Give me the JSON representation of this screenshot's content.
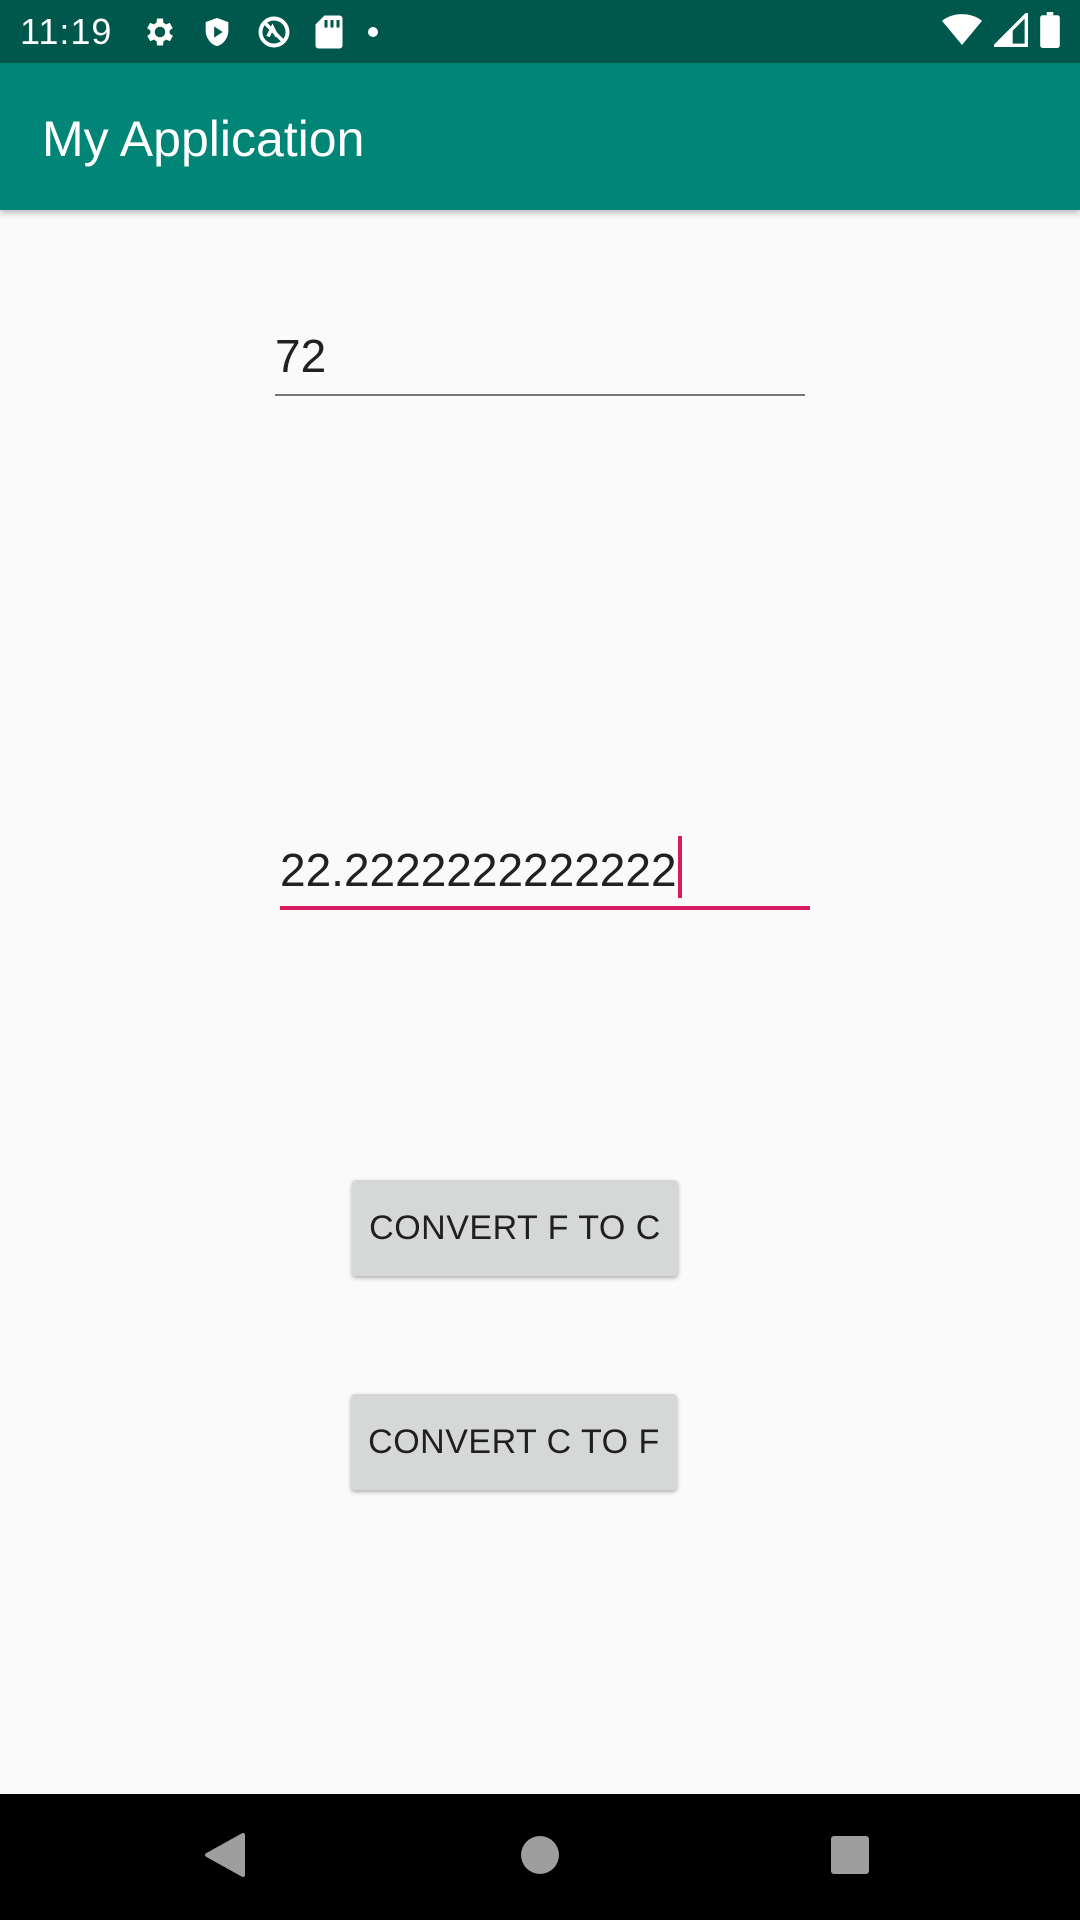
{
  "status_bar": {
    "time": "11:19",
    "left_icons": [
      "gear-icon",
      "shield-icon",
      "vpn-key-icon",
      "sd-card-icon",
      "dot-icon"
    ],
    "right_icons": [
      "wifi-icon",
      "cell-signal-icon",
      "battery-icon"
    ]
  },
  "app_bar": {
    "title": "My Application"
  },
  "fields": {
    "fahrenheit_value": "72",
    "celsius_value": "22.2222222222222"
  },
  "buttons": {
    "f_to_c": "CONVERT F TO C",
    "c_to_f": "CONVERT C TO F"
  },
  "nav_bar": {
    "icons": [
      "back-icon",
      "home-icon",
      "recents-icon"
    ]
  },
  "colors": {
    "status_bar": "#00574b",
    "app_bar": "#008577",
    "accent": "#d81b60",
    "button": "#d6d7d7"
  }
}
